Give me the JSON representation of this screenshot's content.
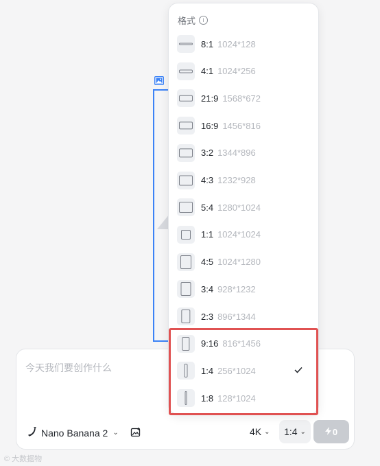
{
  "prompt": {
    "placeholder": "今天我们要创作什么"
  },
  "toolbar": {
    "model_label": "Nano Banana 2",
    "resolution_label": "4K",
    "ratio_label": "1:4",
    "generate_cost": "0"
  },
  "format_menu": {
    "header": "格式",
    "options": [
      {
        "label": "8:1",
        "resolution": "1024*128"
      },
      {
        "label": "4:1",
        "resolution": "1024*256"
      },
      {
        "label": "21:9",
        "resolution": "1568*672"
      },
      {
        "label": "16:9",
        "resolution": "1456*816"
      },
      {
        "label": "3:2",
        "resolution": "1344*896"
      },
      {
        "label": "4:3",
        "resolution": "1232*928"
      },
      {
        "label": "5:4",
        "resolution": "1280*1024"
      },
      {
        "label": "1:1",
        "resolution": "1024*1024"
      },
      {
        "label": "4:5",
        "resolution": "1024*1280"
      },
      {
        "label": "3:4",
        "resolution": "928*1232"
      },
      {
        "label": "2:3",
        "resolution": "896*1344"
      },
      {
        "label": "9:16",
        "resolution": "816*1456"
      },
      {
        "label": "1:4",
        "resolution": "256*1024",
        "selected": true
      },
      {
        "label": "1:8",
        "resolution": "128*1024"
      }
    ]
  },
  "watermark": "© 大数据物"
}
